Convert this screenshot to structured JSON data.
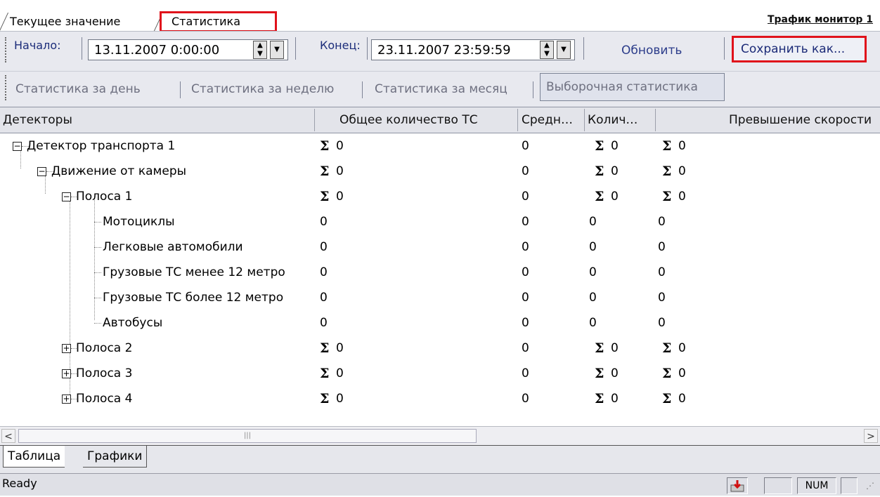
{
  "tabs": {
    "current": "Текущее значение",
    "stats": "Статистика",
    "traffic_link": "Трафик монитор 1"
  },
  "toolbar": {
    "start_label": "Начало:",
    "start_value": "13.11.2007 0:00:00",
    "end_label": "Конец:",
    "end_value": "23.11.2007 23:59:59",
    "refresh": "Обновить",
    "save_as": "Сохранить как...",
    "stat_day": "Статистика за день",
    "stat_week": "Статистика за неделю",
    "stat_month": "Статистика за месяц",
    "stat_selective": "Выборочная статистика"
  },
  "grid": {
    "columns": [
      "Детекторы",
      "Общее количество ТС",
      "Средн…",
      "Колич…",
      "Превышение скорости"
    ],
    "rows": [
      {
        "name": "Детектор транспорта 1",
        "total": "0",
        "avg": "0",
        "count": "0",
        "speed": "0"
      },
      {
        "name": "Движение от камеры",
        "total": "0",
        "avg": "0",
        "count": "0",
        "speed": "0"
      },
      {
        "name": "Полоса 1",
        "total": "0",
        "avg": "0",
        "count": "0",
        "speed": "0"
      },
      {
        "name": "Мотоциклы",
        "total": "0",
        "avg": "0",
        "count": "0",
        "speed": "0"
      },
      {
        "name": "Легковые автомобили",
        "total": "0",
        "avg": "0",
        "count": "0",
        "speed": "0"
      },
      {
        "name": "Грузовые ТС менее 12 метро",
        "total": "0",
        "avg": "0",
        "count": "0",
        "speed": "0"
      },
      {
        "name": "Грузовые ТС более 12 метро",
        "total": "0",
        "avg": "0",
        "count": "0",
        "speed": "0"
      },
      {
        "name": "Автобусы",
        "total": "0",
        "avg": "0",
        "count": "0",
        "speed": "0"
      },
      {
        "name": "Полоса 2",
        "total": "0",
        "avg": "0",
        "count": "0",
        "speed": "0"
      },
      {
        "name": "Полоса 3",
        "total": "0",
        "avg": "0",
        "count": "0",
        "speed": "0"
      },
      {
        "name": "Полоса 4",
        "total": "0",
        "avg": "0",
        "count": "0",
        "speed": "0"
      }
    ],
    "sigma": "Σ",
    "expand_collapsed": "+",
    "expand_open": "−"
  },
  "scroll": {
    "thumb_grip": "|||",
    "left_arrow": "<",
    "right_arrow": ">"
  },
  "bottom_tabs": {
    "table": "Таблица",
    "charts": "Графики"
  },
  "status": {
    "text": "Ready",
    "num": "NUM"
  },
  "colors": {
    "highlight": "#e0121b",
    "toolbar_bg": "#e8e9ef"
  }
}
